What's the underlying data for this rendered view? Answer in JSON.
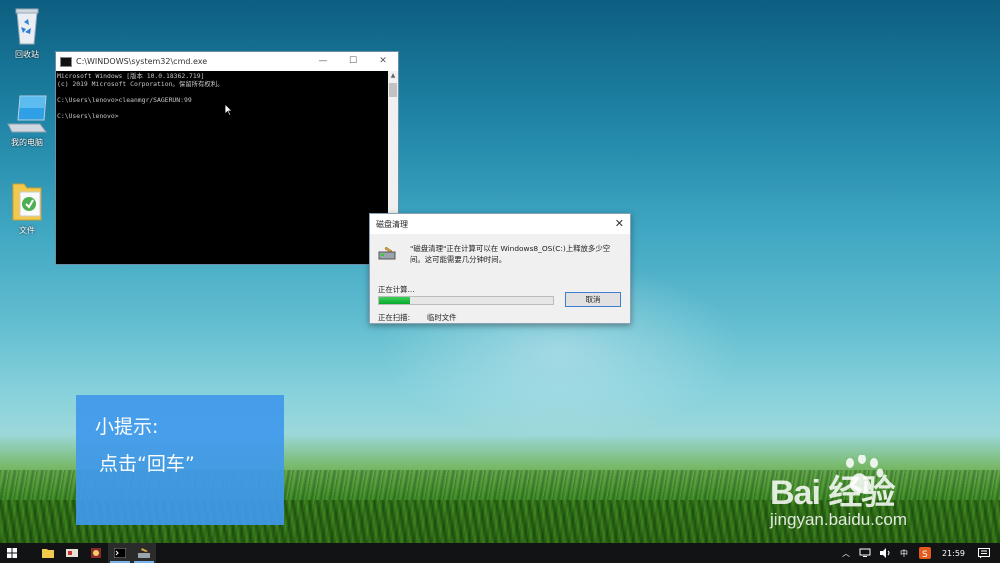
{
  "desktop": {
    "icons": [
      {
        "label": "回收站",
        "icon": "recycle-bin-icon"
      },
      {
        "label": "我的电脑",
        "icon": "computer-icon"
      },
      {
        "label": "文件",
        "icon": "folder-icon"
      }
    ]
  },
  "cmd": {
    "title": "C:\\WINDOWS\\system32\\cmd.exe",
    "lines": [
      "Microsoft Windows [版本 10.0.18362.719]",
      "(c) 2019 Microsoft Corporation。保留所有权利。",
      "",
      "C:\\Users\\lenovo>cleanmgr/SAGERUN:99",
      "",
      "C:\\Users\\lenovo>"
    ],
    "buttons": {
      "minimize": "—",
      "maximize": "☐",
      "close": "✕"
    }
  },
  "dialog": {
    "title": "磁盘清理",
    "message": "\"磁盘清理\"正在计算可以在 Windows8_OS(C:)上释放多少空间。这可能需要几分钟时间。",
    "status": "正在计算...",
    "progress": 0.18,
    "cancel_label": "取消",
    "scan_label": "正在扫描:",
    "scan_value": "临时文件",
    "close": "✕"
  },
  "tip": {
    "line1": "小提示:",
    "line2": "点击“回车”"
  },
  "watermark": {
    "logo": "Bai  经验",
    "url": "jingyan.baidu.com"
  },
  "taskbar": {
    "apps": [
      "file-explorer-icon",
      "mail-icon",
      "media-icon",
      "cmd-icon",
      "disk-cleanup-icon"
    ],
    "tray": {
      "ime": "中",
      "clock": "21:59"
    }
  },
  "colors": {
    "tip_bg": "#4099eb",
    "progress": "#07a82c",
    "taskbar": "#111314"
  }
}
